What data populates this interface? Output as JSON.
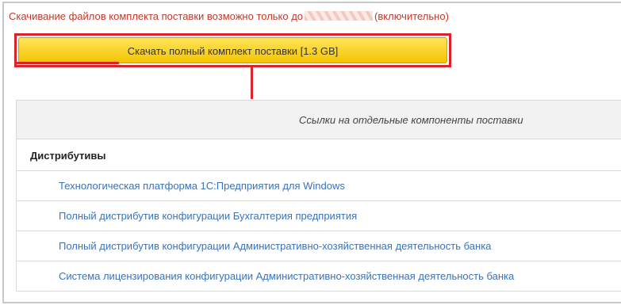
{
  "notice": {
    "text_before": "Скачивание файлов комплекта поставки возможно только до",
    "text_after": "(включительно)"
  },
  "download_button": {
    "label": "Скачать полный комплект поставки [1.3 GB]"
  },
  "components_table": {
    "header": "Ссылки на отдельные компоненты поставки",
    "section": {
      "title": "Дистрибутивы",
      "items": [
        {
          "label": "Технологическая платформа 1С:Предприятия для Windows"
        },
        {
          "label": "Полный дистрибутив конфигурации Бухгалтерия предприятия"
        },
        {
          "label": "Полный дистрибутив конфигурации Административно-хозяйственная деятельность банка"
        },
        {
          "label": "Система лицензирования конфигурации Административно-хозяйственная деятельность банка"
        }
      ]
    }
  },
  "colors": {
    "notice_text": "#c0392b",
    "highlight": "#d7252b",
    "button_fill": "#f5c400",
    "link": "#3b73b9"
  }
}
